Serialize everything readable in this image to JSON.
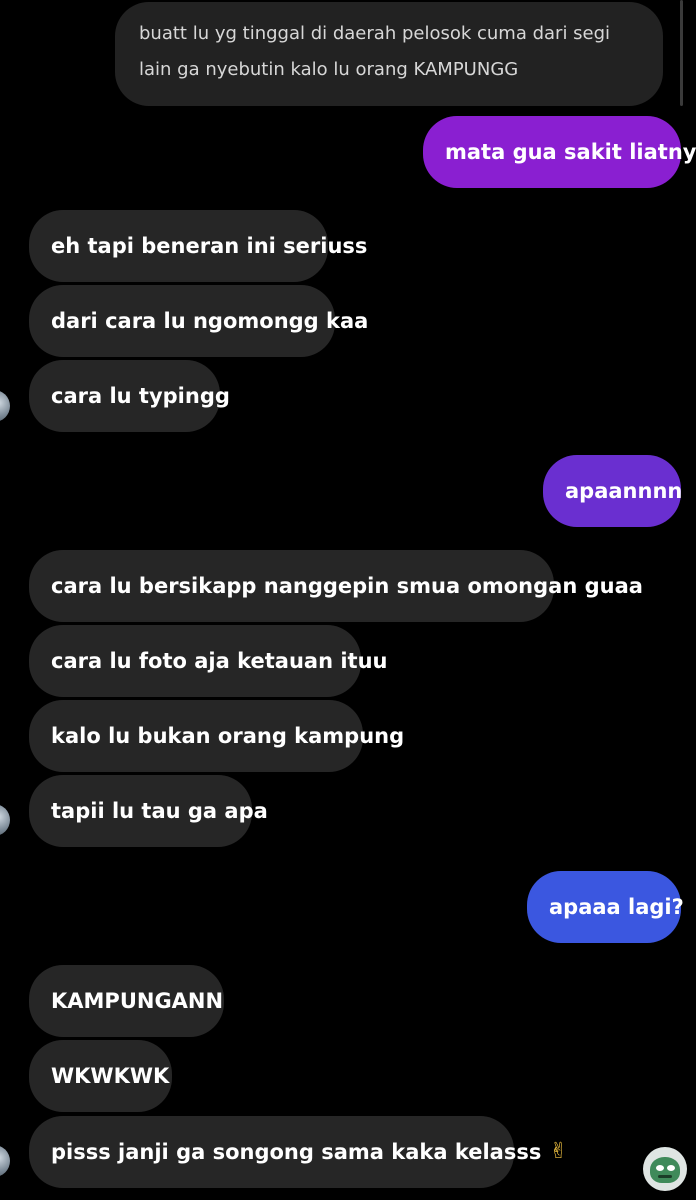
{
  "quoted_message": {
    "text": "buatt lu yg tinggal di daerah pelosok cuma dari segi lain ga nyebutin kalo lu orang KAMPUNGG"
  },
  "messages": [
    {
      "side": "sent",
      "text": "mata gua sakit liatnya",
      "color": "#8a1fd1"
    },
    {
      "side": "received",
      "text": "eh tapi beneran ini seriuss"
    },
    {
      "side": "received",
      "text": "dari cara lu ngomongg kaa"
    },
    {
      "side": "received",
      "text": "cara lu typingg"
    },
    {
      "side": "sent",
      "text": "apaannnn",
      "color": "#6a2fd0"
    },
    {
      "side": "received",
      "text": "cara lu bersikapp nanggepin smua omongan guaa"
    },
    {
      "side": "received",
      "text": "cara lu foto aja ketauan ituu"
    },
    {
      "side": "received",
      "text": "kalo lu bukan orang kampung"
    },
    {
      "side": "received",
      "text": "tapii lu tau ga apa"
    },
    {
      "side": "sent",
      "text": "apaaa lagi?",
      "color": "#3b57e0"
    },
    {
      "side": "received",
      "text": "KAMPUNGANN"
    },
    {
      "side": "received",
      "text": "WKWKWK"
    },
    {
      "side": "received",
      "text": "pisss janji ga songong sama kaka kelasss",
      "emoji": "✌"
    }
  ],
  "icons": {
    "contact_avatar": "contact-avatar-icon",
    "self_avatar": "frog-avatar-icon",
    "peace_emoji": "victory-hand-icon"
  },
  "colors": {
    "background": "#000000",
    "received_bubble": "#262626"
  }
}
